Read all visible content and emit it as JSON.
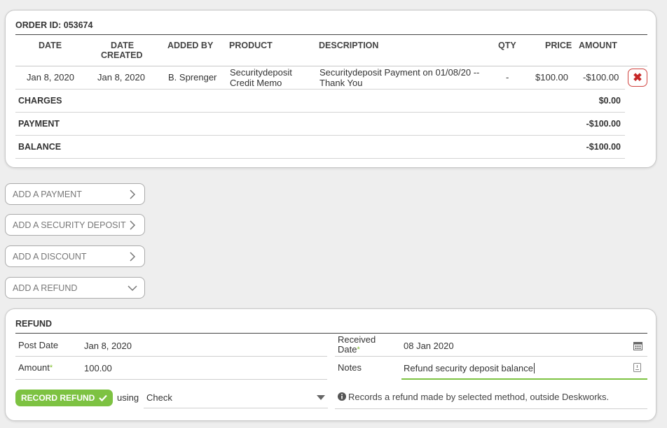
{
  "order": {
    "title": "ORDER ID: 053674",
    "columns": {
      "date": "DATE",
      "date_created_1": "DATE",
      "date_created_2": "CREATED",
      "added_by": "ADDED BY",
      "product": "PRODUCT",
      "description": "DESCRIPTION",
      "qty": "QTY",
      "price": "PRICE",
      "amount": "AMOUNT"
    },
    "rows": [
      {
        "date": "Jan 8, 2020",
        "date_created": "Jan 8, 2020",
        "added_by": "B. Sprenger",
        "product_1": "Securitydeposit",
        "product_2": "Credit Memo",
        "description_1": "Securitydeposit Payment on 01/08/20 --",
        "description_2": "Thank You",
        "qty": "-",
        "price": "$100.00",
        "amount": "-$100.00",
        "delete_icon": "x-icon"
      }
    ],
    "summary": {
      "charges_label": "CHARGES",
      "charges_value": "$0.00",
      "payment_label": "PAYMENT",
      "payment_value": "-$100.00",
      "balance_label": "BALANCE",
      "balance_value": "-$100.00"
    }
  },
  "actions": [
    {
      "label": "ADD A PAYMENT",
      "icon": "chevron-right-icon"
    },
    {
      "label": "ADD A SECURITY DEPOSIT",
      "icon": "chevron-right-icon"
    },
    {
      "label": "ADD A DISCOUNT",
      "icon": "chevron-right-icon"
    },
    {
      "label": "ADD A REFUND",
      "icon": "chevron-down-icon"
    }
  ],
  "refund": {
    "title": "REFUND",
    "post_date_label": "Post Date",
    "post_date_value": "Jan 8, 2020",
    "amount_label": "Amount",
    "amount_value": "100.00",
    "received_date_label_1": "Received",
    "received_date_label_2": "Date",
    "received_date_value": "08 Jan 2020",
    "notes_label": "Notes",
    "notes_value": "Refund security deposit balance",
    "record_button": "RECORD REFUND",
    "using_label": "using",
    "method_value": "Check",
    "info_text": "Records a refund made by selected method, outside Deskworks.",
    "colors": {
      "accent": "#7dc242",
      "delete": "#c62828"
    }
  }
}
